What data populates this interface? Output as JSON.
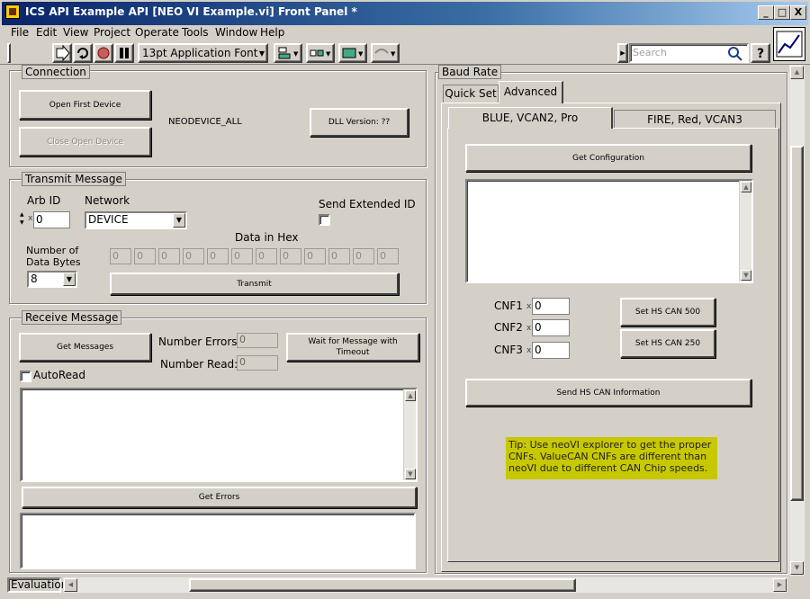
{
  "window": {
    "title": "ICS API Example API [NEO VI Example.vi] Front Panel *",
    "min_glyph": "_",
    "max_glyph": "□",
    "close_glyph": "X"
  },
  "menu": [
    "File",
    "Edit",
    "View",
    "Project",
    "Operate",
    "Tools",
    "Window",
    "Help"
  ],
  "toolbar": {
    "font_select": "13pt Application Font",
    "search_placeholder": "Search"
  },
  "connection": {
    "label": "Connection",
    "open_first_device": "Open First Device",
    "close_open_device": "Close Open Device",
    "device_name": "NEODEVICE_ALL",
    "dll_version": "DLL Version: ??"
  },
  "transmit": {
    "label": "Transmit Message",
    "arb_id_label": "Arb ID",
    "arb_id_prefix": "x",
    "arb_id_value": "0",
    "network_label": "Network",
    "network_value": "DEVICE",
    "send_extended_label": "Send Extended ID",
    "data_in_hex_label": "Data in Hex",
    "num_bytes_label_1": "Number of",
    "num_bytes_label_2": "Data Bytes",
    "num_bytes_value": "8",
    "hex_values": [
      "0",
      "0",
      "0",
      "0",
      "0",
      "0",
      "0",
      "0",
      "0",
      "0",
      "0",
      "0"
    ],
    "transmit_button": "Transmit"
  },
  "receive": {
    "label": "Receive Message",
    "get_messages": "Get Messages",
    "number_errors_label": "Number Errors:",
    "number_errors_value": "0",
    "number_read_label": "Number Read:",
    "number_read_value": "0",
    "wait_button_1": "Wait for Message with",
    "wait_button_2": "Timeout",
    "autoread_label": "AutoRead",
    "get_errors": "Get Errors"
  },
  "baud": {
    "label": "Baud Rate",
    "tabs": [
      "Quick Set",
      "Advanced"
    ],
    "subtabs": [
      "BLUE, VCAN2, Pro",
      "FIRE, Red, VCAN3"
    ],
    "get_configuration": "Get Configuration",
    "cnf1_label": "CNF1",
    "cnf2_label": "CNF2",
    "cnf3_label": "CNF3",
    "cnf_prefix": "x",
    "cnf1": "0",
    "cnf2": "0",
    "cnf3": "0",
    "set_500": "Set HS CAN 500",
    "set_250": "Set HS CAN 250",
    "send_info": "Send HS CAN Information",
    "tip": "Tip: Use neoVI explorer to get the proper CNFs. ValueCAN CNFs are different than neoVI due to different CAN Chip speeds."
  },
  "status": {
    "mode": "Evaluation"
  },
  "colors": {
    "title_start": "#0a246a",
    "title_end": "#a6caf0",
    "panel": "#d4d0c8",
    "tip_bg": "#c8c800"
  }
}
